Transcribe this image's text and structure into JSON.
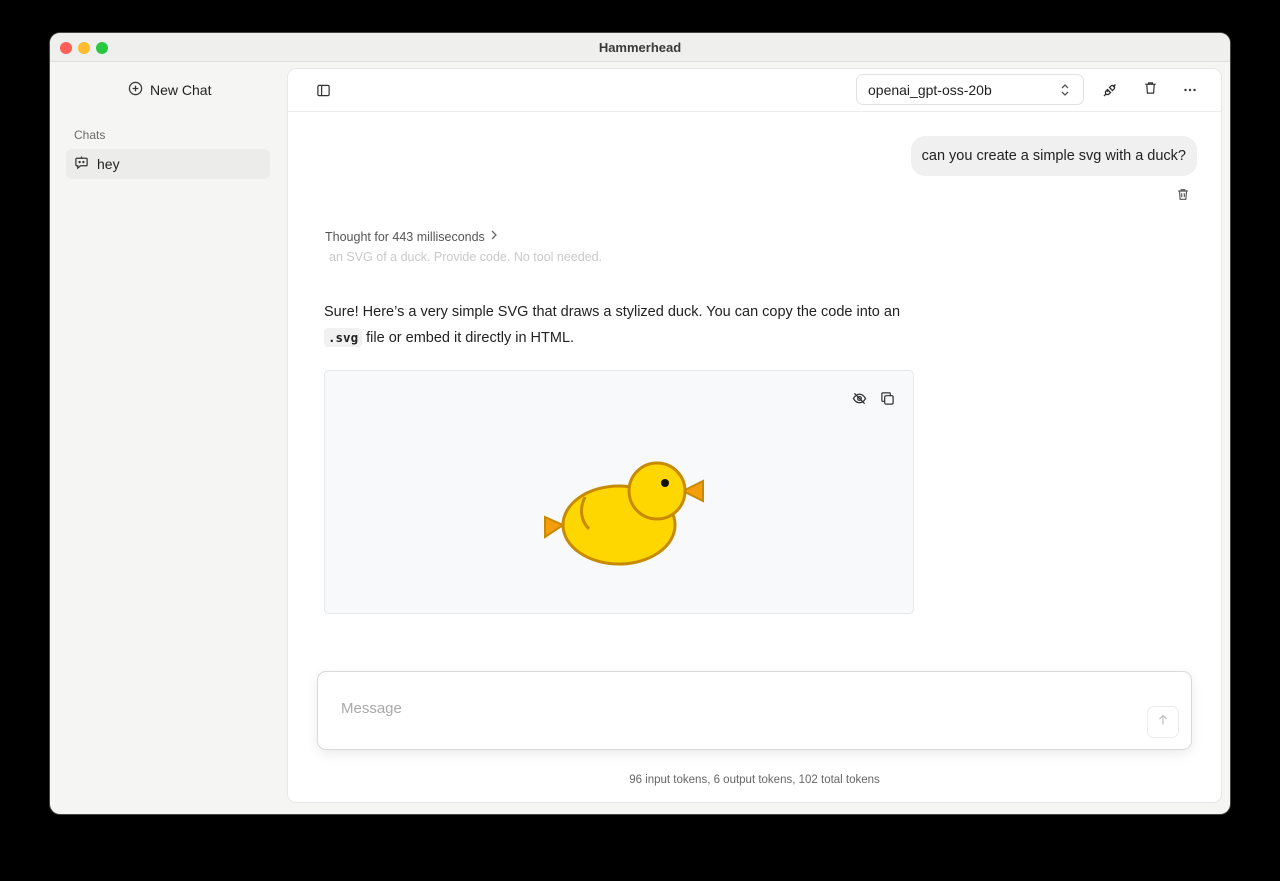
{
  "window": {
    "title": "Hammerhead"
  },
  "sidebar": {
    "new_chat_label": "New Chat",
    "chats_heading": "Chats",
    "chats": [
      {
        "label": "hey"
      }
    ]
  },
  "toolbar": {
    "model_value": "openai_gpt-oss-20b"
  },
  "conversation": {
    "user_message": "can you create a simple svg with a duck?",
    "thought_label": "Thought for 443 milliseconds",
    "thought_preview": "an SVG of a duck. Provide code. No tool needed.",
    "answer_part1": "Sure! Here’s a very simple SVG that draws a stylized duck. You can copy the code into an",
    "answer_code": ".svg",
    "answer_part2": "file or embed it directly in HTML."
  },
  "composer": {
    "placeholder": "Message",
    "value": ""
  },
  "token_stats": "96 input tokens, 6 output tokens, 102 total tokens",
  "icons": {
    "new_chat": "plus-circle-icon",
    "chat_item": "bot-chat-icon",
    "sidebar_toggle": "sidebar-toggle-icon",
    "model_chevron": "chevron-up-down-icon",
    "plug": "plug-icon",
    "trash": "trash-icon",
    "more": "more-horizontal-icon",
    "thought_chevron": "chevron-right-icon",
    "hide_preview": "eye-off-icon",
    "copy": "copy-icon",
    "send": "arrow-up-icon"
  },
  "colors": {
    "duck_body": "#ffd700",
    "duck_outline": "#c88a00",
    "duck_beak": "#f59e0b"
  }
}
